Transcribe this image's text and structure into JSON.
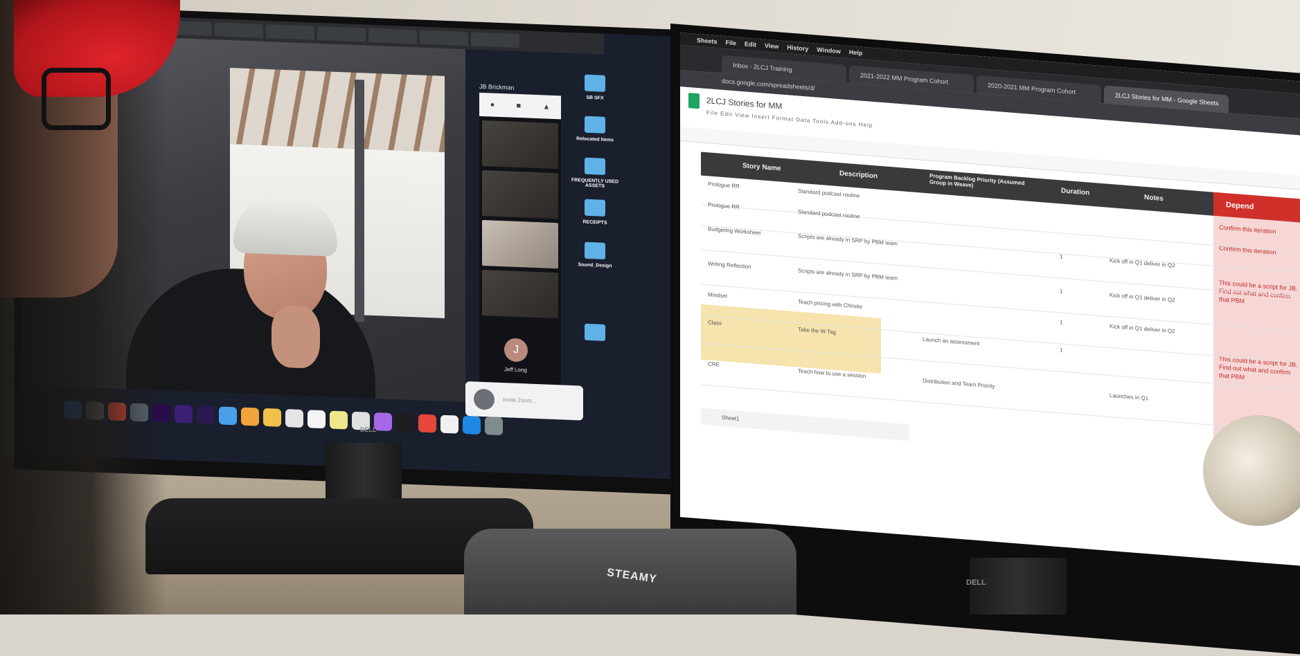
{
  "scene": {
    "left_monitor": {
      "browser_tabs": [
        "",
        "",
        "",
        "",
        "",
        "",
        "",
        "",
        ""
      ],
      "zoom": {
        "participants": [
          {
            "label": "JB Brickman"
          },
          {
            "label": "Jeff Long",
            "avatar_letter": "J"
          }
        ],
        "notification": {
          "text": "Invite Zoom..."
        }
      },
      "desktop_items": [
        {
          "label": "SB SFX"
        },
        {
          "label": "Relocated Items"
        },
        {
          "label": "FREQUENTLY USED ASSETS"
        },
        {
          "label": "RECEIPTS"
        },
        {
          "label": "Sound_Design"
        }
      ],
      "dock_colors": [
        "#2b7de9",
        "#7a7a7a",
        "#e14c3c",
        "#5f6b7a",
        "#2a0b4f",
        "#3a1f75",
        "#2a1a4f",
        "#4aa0e8",
        "#f2a33a",
        "#f0c14b",
        "#e5e5e5",
        "#f5f5f5",
        "#f0e68c",
        "#e0e0e0",
        "#a668e8",
        "#1d1d1f",
        "#e5473b",
        "#f0f0f0",
        "#1e88e5",
        "#7f8c8d"
      ],
      "brand": "DELL"
    },
    "right_monitor": {
      "mac_menu": [
        "Sheets",
        "File",
        "Edit",
        "View",
        "History",
        "Window",
        "Help"
      ],
      "chrome_tabs": [
        {
          "label": "Inbox - 2LCJ Training",
          "active": false
        },
        {
          "label": "2021-2022 MM Program Cohort",
          "active": false
        },
        {
          "label": "2020-2021 MM Program Cohort",
          "active": false
        },
        {
          "label": "2LCJ Stories for MM - Google Sheets",
          "active": true
        }
      ],
      "url": "docs.google.com/spreadsheets/d/",
      "sheet_title": "2LCJ Stories for MM",
      "sheet_menu": "File  Edit  View  Insert  Format  Data  Tools  Add-ons  Help",
      "table": {
        "headers": [
          "Story Name",
          "Description",
          "Program Backlog Priority (Assumed Group in Weave)",
          "Duration",
          "Notes"
        ],
        "dependency_header": "Depend",
        "rows": [
          {
            "name": "Prologue RR",
            "description": "Standard podcast routine"
          },
          {
            "name": "Prologue RR",
            "description": "Standard podcast routine"
          },
          {
            "name": "Budgeting Worksheet",
            "description": "Scripts are already in SRP by PBM team",
            "duration": "1",
            "notes": "Kick off in Q1 deliver in Q2"
          },
          {
            "name": "Writing Reflection",
            "description": "Scripts are already in SRP by PBM team",
            "duration": "1",
            "notes": "Kick off in Q1 deliver in Q2"
          },
          {
            "name": "Mindset",
            "description": "Teach pricing with Christie",
            "duration": "1",
            "notes": "Kick off in Q1 deliver in Q2"
          },
          {
            "name": "Class",
            "description": "Take the W Tag",
            "priority": "Launch an assessment",
            "duration": "1"
          },
          {
            "name": "CRE",
            "description": "Teach how to use a session",
            "priority": "Distribution and Team Priority",
            "notes": "Launches in Q1"
          }
        ],
        "dependencies": [
          "Confirm this iteration",
          "Confirm this iteration",
          "This could be a script for JB. Find out what and confirm that PBM",
          "This could be a script for JB. Find out what and confirm that PBM"
        ]
      },
      "sheet_tab": "Sheet1",
      "brand": "DELL"
    },
    "case_label": "STEAMY",
    "colors": {
      "accent_red": "#d0302a",
      "sheet_green": "#1ea362",
      "highlight_yellow": "#f6e3ad"
    }
  }
}
